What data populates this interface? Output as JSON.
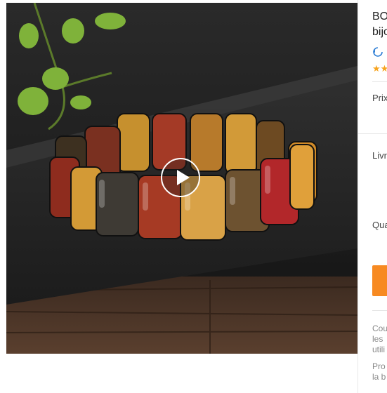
{
  "product": {
    "title_lines": [
      "BO",
      "bijo"
    ],
    "rating_stars": "★★",
    "price_label": "Prix",
    "delivery_label": "Livr",
    "quantity_label": "Qua",
    "info_lines": [
      "Cou",
      "les",
      "utili"
    ],
    "promo_lines": [
      "Pro",
      "la b"
    ]
  },
  "media": {
    "video_play_icon": "play-icon"
  }
}
